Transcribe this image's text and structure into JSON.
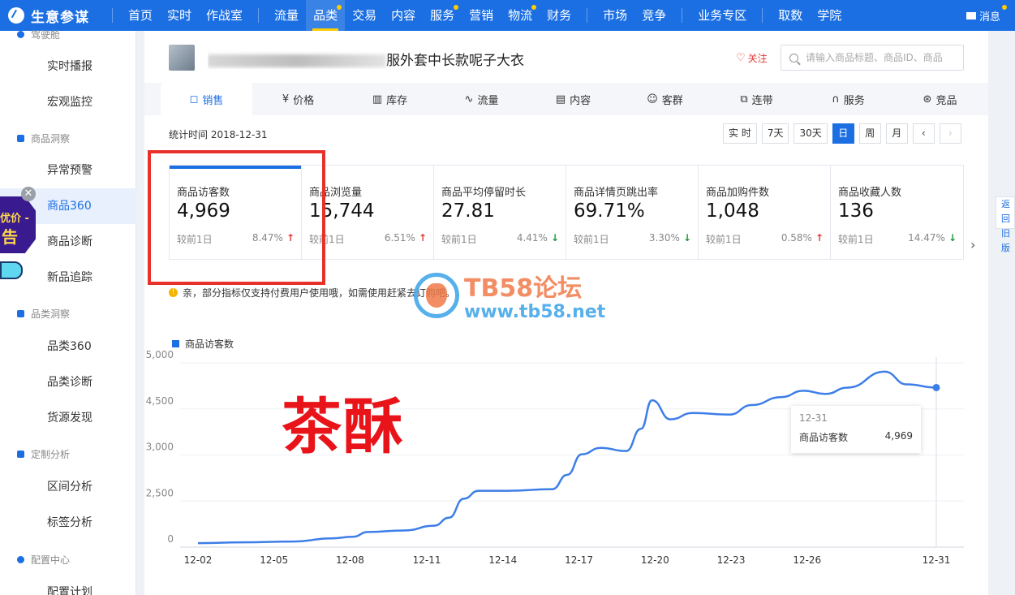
{
  "topnav": {
    "logo": "生意参谋",
    "items": [
      {
        "label": "首页",
        "active": false,
        "dot": false
      },
      {
        "label": "实时",
        "active": false,
        "dot": false
      },
      {
        "label": "作战室",
        "active": false,
        "dot": false
      },
      {
        "label": "流量",
        "active": false,
        "dot": false
      },
      {
        "label": "品类",
        "active": true,
        "dot": true
      },
      {
        "label": "交易",
        "active": false,
        "dot": false
      },
      {
        "label": "内容",
        "active": false,
        "dot": false
      },
      {
        "label": "服务",
        "active": false,
        "dot": true
      },
      {
        "label": "营销",
        "active": false,
        "dot": false
      },
      {
        "label": "物流",
        "active": false,
        "dot": true
      },
      {
        "label": "财务",
        "active": false,
        "dot": false
      },
      {
        "label": "市场",
        "active": false,
        "dot": false
      },
      {
        "label": "竞争",
        "active": false,
        "dot": false
      },
      {
        "label": "业务专区",
        "active": false,
        "dot": false
      },
      {
        "label": "取数",
        "active": false,
        "dot": false
      },
      {
        "label": "学院",
        "active": false,
        "dot": false
      }
    ],
    "message": "消息"
  },
  "sidebar": {
    "top_partial": "驾驶舱",
    "items": [
      {
        "label": "实时播报"
      },
      {
        "label": "宏观监控"
      },
      {
        "label": "异常预警"
      },
      {
        "label": "商品360"
      },
      {
        "label": "商品诊断"
      },
      {
        "label": "新品追踪"
      },
      {
        "label": "品类360"
      },
      {
        "label": "品类诊断"
      },
      {
        "label": "货源发现"
      },
      {
        "label": "区间分析"
      },
      {
        "label": "标签分析"
      },
      {
        "label": "配置计划"
      }
    ],
    "groups": [
      {
        "label": "商品洞察"
      },
      {
        "label": "品类洞察"
      },
      {
        "label": "定制分析"
      },
      {
        "label": "配置中心"
      }
    ]
  },
  "float_ad": {
    "line1": "优价 -",
    "line2": "告"
  },
  "product": {
    "title_visible_tail": "服外套中长款呢子大衣",
    "follow": "关注",
    "search_placeholder": "请输入商品标题、商品ID、商品"
  },
  "tabs": [
    {
      "label": "销售",
      "icon": "bag-icon",
      "glyph": "◻",
      "active": true
    },
    {
      "label": "价格",
      "icon": "yen-icon",
      "glyph": "¥",
      "active": false
    },
    {
      "label": "库存",
      "icon": "warehouse-icon",
      "glyph": "▥",
      "active": false
    },
    {
      "label": "流量",
      "icon": "trend-icon",
      "glyph": "∿",
      "active": false
    },
    {
      "label": "内容",
      "icon": "document-icon",
      "glyph": "▤",
      "active": false
    },
    {
      "label": "客群",
      "icon": "users-icon",
      "glyph": "☺",
      "active": false
    },
    {
      "label": "连带",
      "icon": "link-icon",
      "glyph": "⧉",
      "active": false
    },
    {
      "label": "服务",
      "icon": "headset-icon",
      "glyph": "∩",
      "active": false
    },
    {
      "label": "竞品",
      "icon": "compare-icon",
      "glyph": "⊛",
      "active": false
    }
  ],
  "stat_time": "统计时间 2018-12-31",
  "date_buttons": [
    "实 时",
    "7天",
    "30天",
    "日",
    "周",
    "月"
  ],
  "date_active": "日",
  "cards": [
    {
      "title": "商品访客数",
      "value": "4,969",
      "compare": "较前1日",
      "pct": "8.47%",
      "dir": "up"
    },
    {
      "title": "商品浏览量",
      "value": "15,744",
      "compare": "较前1日",
      "pct": "6.51%",
      "dir": "up"
    },
    {
      "title": "商品平均停留时长",
      "value": "27.81",
      "compare": "较前1日",
      "pct": "4.41%",
      "dir": "down"
    },
    {
      "title": "商品详情页跳出率",
      "value": "69.71%",
      "compare": "较前1日",
      "pct": "3.30%",
      "dir": "down"
    },
    {
      "title": "商品加购件数",
      "value": "1,048",
      "compare": "较前1日",
      "pct": "0.58%",
      "dir": "up"
    },
    {
      "title": "商品收藏人数",
      "value": "136",
      "compare": "较前1日",
      "pct": "14.47%",
      "dir": "down"
    }
  ],
  "notice": "亲，部分指标仅支持付费用户使用哦，如需使用赶紧去订购吧。",
  "chart_data": {
    "type": "line",
    "legend": "商品访客数",
    "y_tick_labels": [
      "0",
      "2,500",
      "3,000",
      "4,500",
      "5,000"
    ],
    "x_tick_labels": [
      "12-02",
      "12-05",
      "12-08",
      "12-11",
      "12-14",
      "12-17",
      "12-20",
      "12-23",
      "12-26",
      "12-31"
    ],
    "series": [
      {
        "name": "商品访客数",
        "color": "#3d7ee8",
        "points": [
          {
            "t": 0.0,
            "v": 0.02
          },
          {
            "t": 0.06,
            "v": 0.025
          },
          {
            "t": 0.13,
            "v": 0.03
          },
          {
            "t": 0.18,
            "v": 0.05
          },
          {
            "t": 0.21,
            "v": 0.06
          },
          {
            "t": 0.23,
            "v": 0.09
          },
          {
            "t": 0.28,
            "v": 0.1
          },
          {
            "t": 0.32,
            "v": 0.13
          },
          {
            "t": 0.34,
            "v": 0.18
          },
          {
            "t": 0.36,
            "v": 0.3
          },
          {
            "t": 0.38,
            "v": 0.35
          },
          {
            "t": 0.42,
            "v": 0.35
          },
          {
            "t": 0.48,
            "v": 0.36
          },
          {
            "t": 0.5,
            "v": 0.45
          },
          {
            "t": 0.52,
            "v": 0.58
          },
          {
            "t": 0.545,
            "v": 0.62
          },
          {
            "t": 0.58,
            "v": 0.6
          },
          {
            "t": 0.6,
            "v": 0.74
          },
          {
            "t": 0.615,
            "v": 0.92
          },
          {
            "t": 0.64,
            "v": 0.8
          },
          {
            "t": 0.67,
            "v": 0.84
          },
          {
            "t": 0.72,
            "v": 0.83
          },
          {
            "t": 0.75,
            "v": 0.89
          },
          {
            "t": 0.79,
            "v": 0.94
          },
          {
            "t": 0.82,
            "v": 0.98
          },
          {
            "t": 0.85,
            "v": 0.96
          },
          {
            "t": 0.88,
            "v": 1.0
          },
          {
            "t": 0.93,
            "v": 1.1
          },
          {
            "t": 0.96,
            "v": 1.02
          },
          {
            "t": 1.0,
            "v": 1.0
          }
        ]
      }
    ],
    "tooltip": {
      "date": "12-31",
      "label": "商品访客数",
      "value": "4,969"
    }
  },
  "watermark": {
    "title": "TB58论坛",
    "url": "www.tb58.net"
  },
  "overlay_text": "茶酥",
  "right_edge": {
    "line1": "返回",
    "line2": "旧版"
  }
}
